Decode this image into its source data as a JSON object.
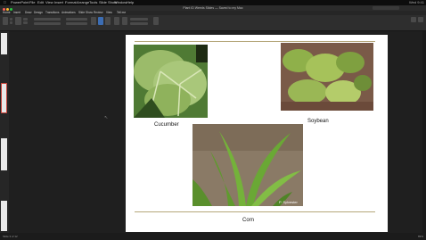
{
  "menubar": {
    "items": [
      "PowerPoint",
      "File",
      "Edit",
      "View",
      "Insert",
      "Format",
      "Arrange",
      "Tools",
      "Slide Show",
      "Window",
      "Help"
    ],
    "status": "Wed 9:41"
  },
  "titlebar": {
    "title": "Plant ID Weeds Slides — Saved to my Mac"
  },
  "tabs": [
    "Home",
    "Insert",
    "Draw",
    "Design",
    "Transitions",
    "Animations",
    "Slide Show",
    "Review",
    "View",
    "Tell me"
  ],
  "slide": {
    "captions": {
      "cucumber": "Cucumber",
      "soybean": "Soybean",
      "corn": "Corn"
    },
    "credit": "P. Sylvester"
  },
  "statusbar": {
    "left": "Slide 3 of 12",
    "right": "89%"
  },
  "colors": {
    "rule": "#b5a77a",
    "accent": "#c9463d"
  }
}
